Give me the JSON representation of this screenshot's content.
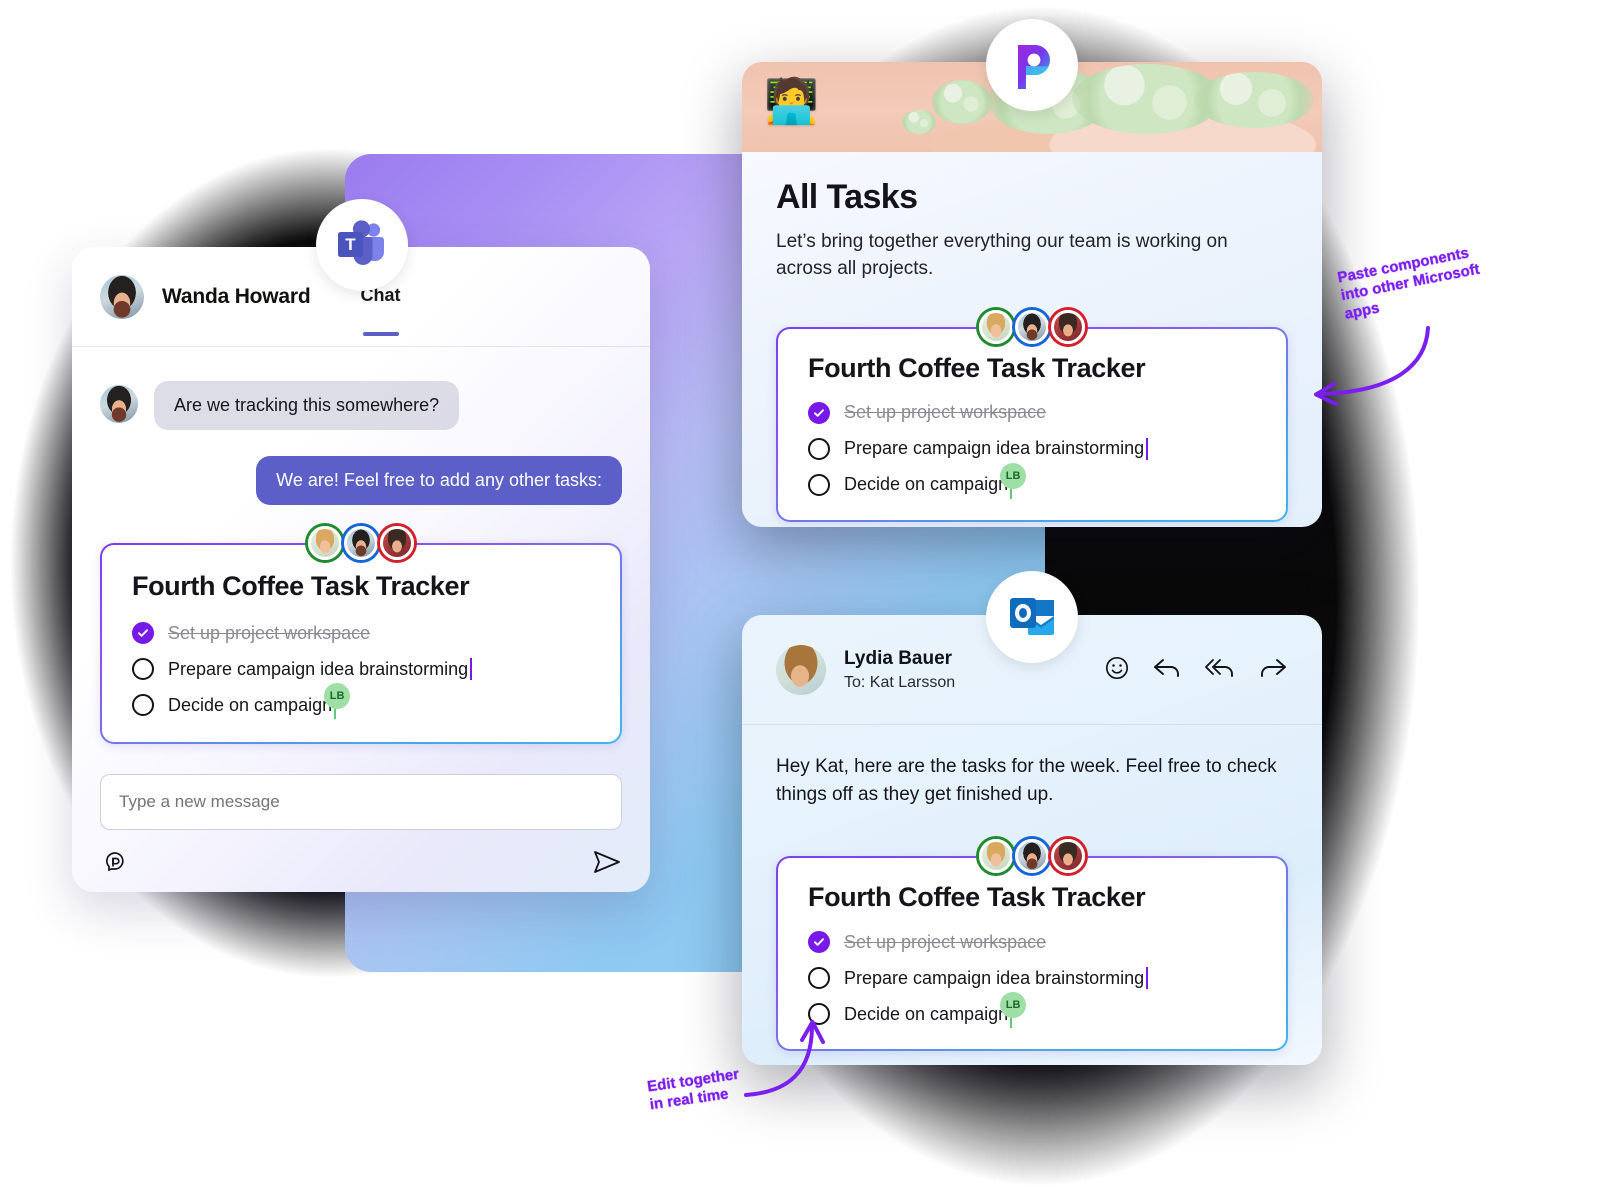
{
  "teams": {
    "app": "microsoft-teams",
    "user_name": "Wanda Howard",
    "tab_label": "Chat",
    "messages": [
      {
        "direction": "incoming",
        "text": "Are we tracking this somewhere?"
      },
      {
        "direction": "outgoing",
        "text": "We are! Feel free to add any other tasks:"
      }
    ],
    "composer": {
      "placeholder": "Type a new message",
      "value": "",
      "loop_icon": "loop-component-icon",
      "send_icon": "send-icon"
    }
  },
  "loop_component": {
    "title": "Fourth Coffee Task Tracker",
    "collaborators": [
      {
        "name": "collaborator-green",
        "ring_color": "#1f8a2e"
      },
      {
        "name": "collaborator-blue",
        "ring_color": "#1565d8"
      },
      {
        "name": "collaborator-red",
        "ring_color": "#d3212c"
      }
    ],
    "tasks": [
      {
        "label": "Set up project workspace",
        "checked": true,
        "cursor": false,
        "presence": null
      },
      {
        "label": "Prepare campaign idea brainstorming",
        "checked": false,
        "cursor": true,
        "presence": null
      },
      {
        "label": "Decide on campaign",
        "checked": false,
        "cursor": false,
        "presence": "LB"
      }
    ]
  },
  "loop_app": {
    "app": "microsoft-loop",
    "title": "All Tasks",
    "subtitle": "Let’s bring together everything our team is working on across all projects.",
    "banner_emoji": "🧑‍💻"
  },
  "outlook": {
    "app": "microsoft-outlook",
    "sender": "Lydia Bauer",
    "recipient": "To: Kat Larsson",
    "body": "Hey Kat, here are the tasks for the week. Feel free to check things off as they get finished up.",
    "actions": [
      {
        "name": "react-emoji-button",
        "icon": "smiley-icon"
      },
      {
        "name": "reply-button",
        "icon": "reply-arrow-icon"
      },
      {
        "name": "reply-all-button",
        "icon": "reply-all-arrow-icon"
      },
      {
        "name": "forward-button",
        "icon": "forward-arrow-icon"
      }
    ]
  },
  "annotations": [
    {
      "name": "paste-components-annotation",
      "line1": "Paste components",
      "line2": "into other Microsoft",
      "line3": "apps"
    },
    {
      "name": "edit-together-annotation",
      "line1": "Edit together",
      "line2": "in real time"
    }
  ],
  "colors": {
    "accent_purple": "#7719e8",
    "teams_purple": "#5b5fc7",
    "annotation_purple": "#7b1ff0",
    "presence_green": "#9ddfa4"
  }
}
